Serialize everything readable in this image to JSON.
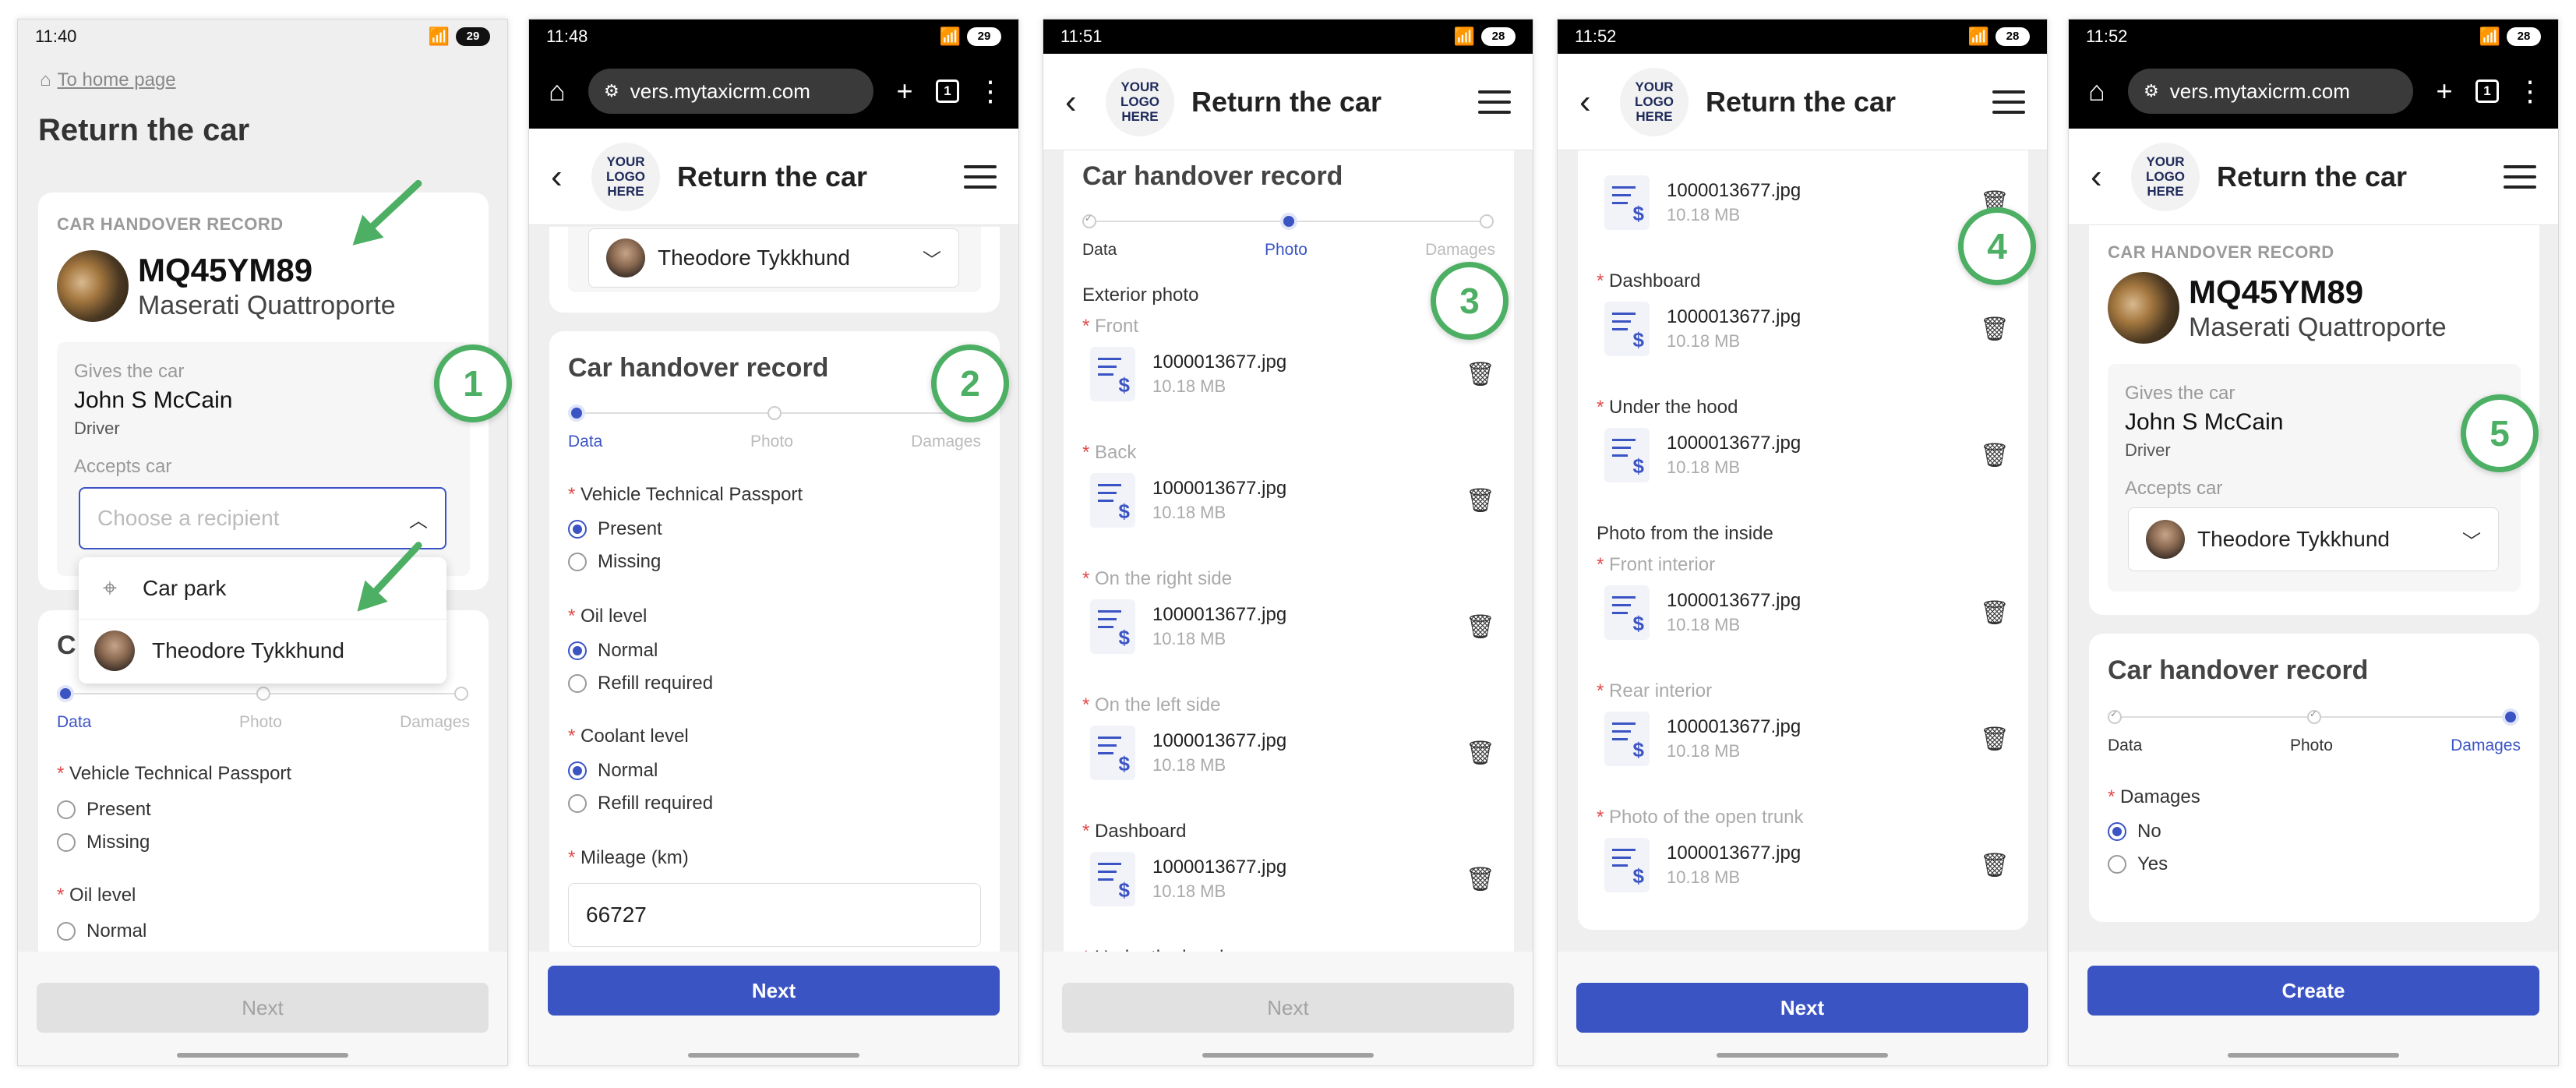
{
  "statusbars": {
    "p1": {
      "time": "11:40",
      "battery": "29"
    },
    "p2": {
      "time": "11:48",
      "battery": "29"
    },
    "p3": {
      "time": "11:51",
      "battery": "28"
    },
    "p4": {
      "time": "11:52",
      "battery": "28"
    },
    "p5": {
      "time": "11:52",
      "battery": "28"
    }
  },
  "browser": {
    "url": "vers.mytaxicrm.com",
    "tab_count": "1"
  },
  "logo_text": "YOUR LOGO HERE",
  "page_title": "Return the car",
  "home_link": "To home page",
  "record_label": "CAR HANDOVER RECORD",
  "record_heading": "Car handover record",
  "car": {
    "plate": "MQ45YM89",
    "model": "Maserati Quattroporte"
  },
  "gives": {
    "label": "Gives the car",
    "name": "John S McCain",
    "role": "Driver"
  },
  "accepts": {
    "label": "Accepts car",
    "placeholder": "Choose a recipient",
    "selected": "Theodore Tykkhund"
  },
  "dropdown_options": [
    "Car park",
    "Theodore Tykkhund"
  ],
  "partial_heading": "C",
  "steps": [
    "Data",
    "Photo",
    "Damages"
  ],
  "fields": {
    "passport": "Vehicle Technical Passport",
    "passport_opts": [
      "Present",
      "Missing"
    ],
    "oil": "Oil level",
    "oil_opts": [
      "Normal",
      "Refill required"
    ],
    "coolant": "Coolant level",
    "coolant_opts": [
      "Normal",
      "Refill required"
    ],
    "mileage": "Mileage (km)",
    "mileage_value": "66727",
    "damages": "Damages",
    "damages_opts": [
      "No",
      "Yes"
    ]
  },
  "photos": {
    "exterior_group": "Exterior photo",
    "interior_group": "Photo from the inside",
    "front": "Front",
    "back": "Back",
    "right": "On the right side",
    "left": "On the left side",
    "dashboard": "Dashboard",
    "hood": "Under the hood",
    "front_interior": "Front interior",
    "rear_interior": "Rear interior",
    "trunk": "Photo of the open trunk",
    "file_name": "1000013677.jpg",
    "file_size": "10.18 MB"
  },
  "buttons": {
    "next": "Next",
    "create": "Create"
  },
  "badges": [
    "1",
    "2",
    "3",
    "4",
    "5"
  ],
  "colors": {
    "accent": "#3b54c4",
    "annotation": "#4caf63",
    "required": "#e24a4a"
  },
  "icons": [
    "home-icon",
    "map-pin-icon",
    "trash-icon",
    "back-arrow-icon",
    "menu-icon",
    "chevron-down-icon",
    "chevron-up-icon",
    "more-vertical-icon",
    "plus-icon",
    "tabs-icon",
    "site-settings-icon"
  ]
}
